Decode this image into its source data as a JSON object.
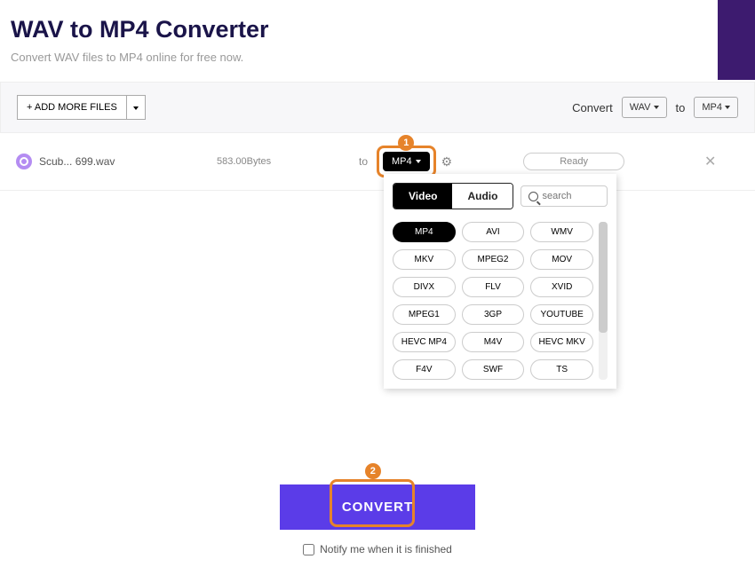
{
  "header": {
    "title": "WAV to MP4 Converter",
    "subtitle": "Convert WAV files to MP4 online for free now."
  },
  "toolbar": {
    "add_files": "+ ADD MORE FILES",
    "convert_label": "Convert",
    "from_format": "WAV",
    "to_label": "to",
    "to_format": "MP4"
  },
  "file": {
    "name": "Scub... 699.wav",
    "size": "583.00Bytes",
    "to_label": "to",
    "format": "MP4",
    "status": "Ready"
  },
  "callouts": {
    "one": "1",
    "two": "2"
  },
  "dropdown": {
    "tab_video": "Video",
    "tab_audio": "Audio",
    "search_placeholder": "search",
    "formats": [
      "MP4",
      "AVI",
      "WMV",
      "MKV",
      "MPEG2",
      "MOV",
      "DIVX",
      "FLV",
      "XVID",
      "MPEG1",
      "3GP",
      "YOUTUBE",
      "HEVC MP4",
      "M4V",
      "HEVC MKV",
      "F4V",
      "SWF",
      "TS"
    ],
    "active_format": "MP4"
  },
  "footer": {
    "convert": "CONVERT",
    "notify": "Notify me when it is finished"
  }
}
